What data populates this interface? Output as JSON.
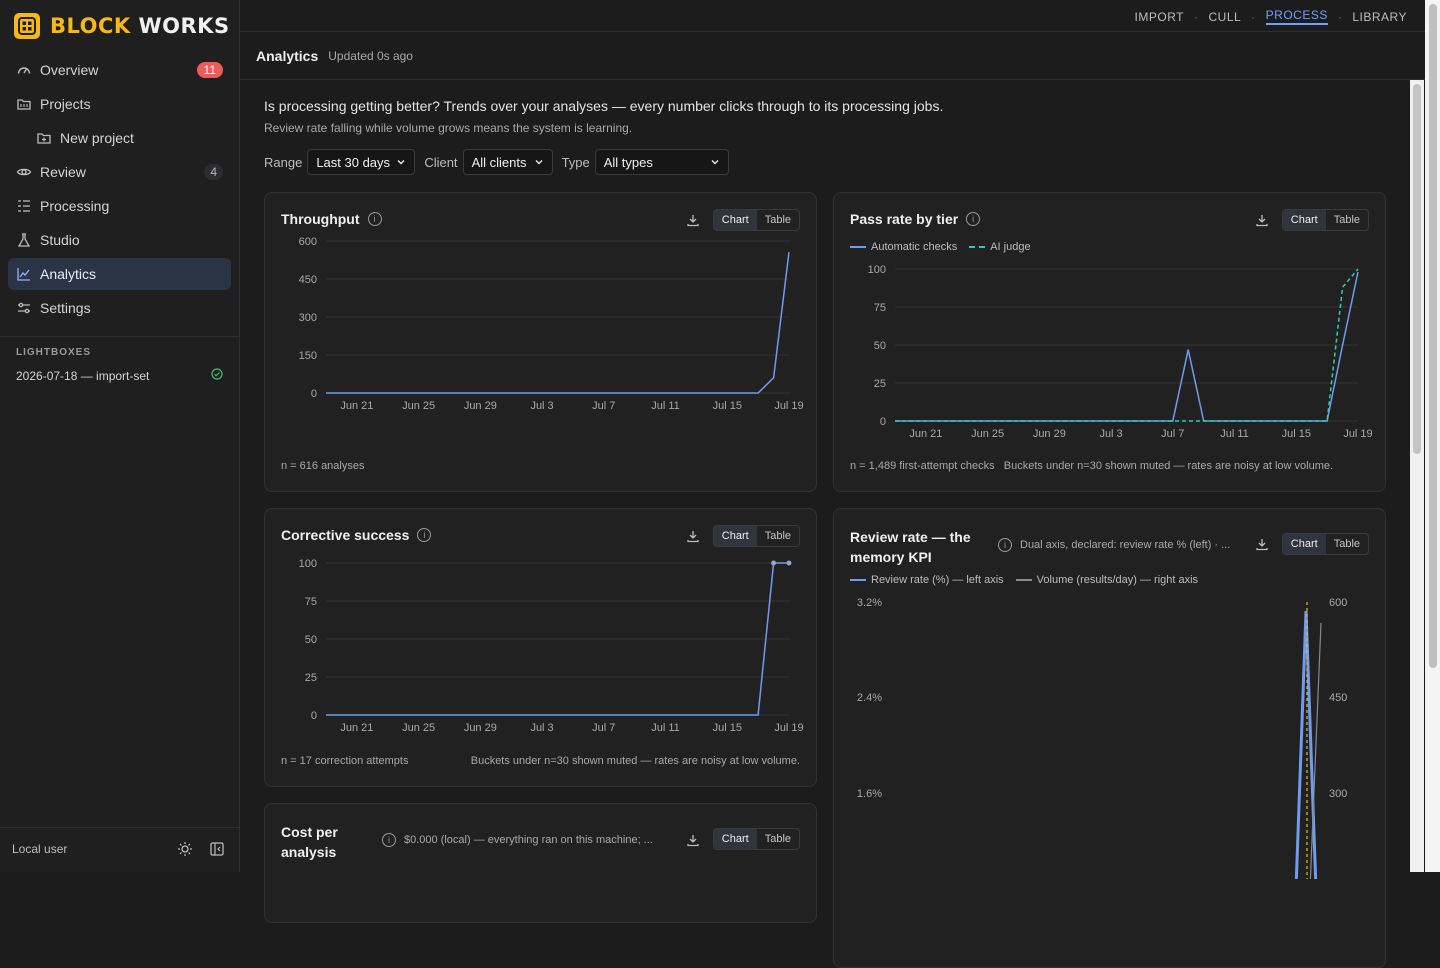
{
  "brand": {
    "part1": "BLOCK",
    "part2": "WORKS"
  },
  "sidebar": {
    "items": [
      {
        "label": "Overview",
        "icon": "gauge-icon",
        "badge": "11"
      },
      {
        "label": "Projects",
        "icon": "folder-icon"
      },
      {
        "label": "New project",
        "icon": "folder-plus-icon"
      },
      {
        "label": "Review",
        "icon": "eye-icon",
        "badge": "4"
      },
      {
        "label": "Processing",
        "icon": "list-icon"
      },
      {
        "label": "Studio",
        "icon": "flask-icon"
      },
      {
        "label": "Analytics",
        "icon": "chart-icon"
      },
      {
        "label": "Settings",
        "icon": "sliders-icon"
      }
    ],
    "lightboxes_heading": "LIGHTBOXES",
    "lightbox_item": "2026-07-18 — import-set",
    "user": "Local user"
  },
  "topnav": [
    "IMPORT",
    "CULL",
    "PROCESS",
    "LIBRARY"
  ],
  "header": {
    "title": "Analytics",
    "updated": "Updated 0s ago"
  },
  "intro": {
    "question": "Is processing getting better? Trends over your analyses — every number clicks through to its processing jobs.",
    "hint": "Review rate falling while volume grows means the system is learning."
  },
  "filters": {
    "range_label": "Range",
    "range_value": "Last 30 days",
    "client_label": "Client",
    "client_value": "All clients",
    "type_label": "Type",
    "type_value": "All types"
  },
  "toggle": {
    "chart": "Chart",
    "table": "Table"
  },
  "colors": {
    "accent": "#6fa0ff",
    "series_blue": "#6f9cf0",
    "series_teal": "#2fd0b0",
    "brand": "#f5b814",
    "badge": "#f15a5a"
  },
  "cards": {
    "throughput": {
      "title": "Throughput",
      "footer": "n = 616 analyses"
    },
    "passrate": {
      "title": "Pass rate by tier",
      "legend1": "Automatic checks",
      "legend2": "AI judge",
      "footer": "n = 1,489 first-attempt checks",
      "footer2": "Buckets under n=30 shown muted — rates are noisy at low volume."
    },
    "corrective": {
      "title": "Corrective success",
      "footer": "n = 17 correction attempts",
      "footer2": "Buckets under n=30 shown muted — rates are noisy at low volume."
    },
    "review": {
      "title1": "Review rate — the",
      "title2": "memory KPI",
      "note": "Dual axis, declared: review rate % (left) · ...",
      "legend1": "Review rate (%) — left axis",
      "legend2": "Volume (results/day) — right axis"
    },
    "cost": {
      "title1": "Cost per",
      "title2": "analysis",
      "note": "$0.000 (local) — everything ran on this machine; ..."
    }
  },
  "chart_data": [
    {
      "type": "line",
      "title": "Throughput",
      "x": [
        "Jun 19",
        "Jun 20",
        "Jun 21",
        "Jun 22",
        "Jun 23",
        "Jun 24",
        "Jun 25",
        "Jun 26",
        "Jun 27",
        "Jun 28",
        "Jun 29",
        "Jun 30",
        "Jul 1",
        "Jul 2",
        "Jul 3",
        "Jul 4",
        "Jul 5",
        "Jul 6",
        "Jul 7",
        "Jul 8",
        "Jul 9",
        "Jul 10",
        "Jul 11",
        "Jul 12",
        "Jul 13",
        "Jul 14",
        "Jul 15",
        "Jul 16",
        "Jul 17",
        "Jul 18",
        "Jul 19"
      ],
      "xticks": [
        "Jun 21",
        "Jun 25",
        "Jun 29",
        "Jul 3",
        "Jul 7",
        "Jul 11",
        "Jul 15",
        "Jul 19"
      ],
      "yticks": [
        0,
        150,
        300,
        450,
        600
      ],
      "ylim": [
        0,
        600
      ],
      "series": [
        {
          "values": [
            0,
            0,
            0,
            0,
            0,
            0,
            0,
            0,
            0,
            0,
            0,
            0,
            0,
            0,
            0,
            0,
            0,
            0,
            0,
            0,
            0,
            0,
            0,
            0,
            0,
            0,
            0,
            0,
            0,
            60,
            556
          ]
        }
      ]
    },
    {
      "type": "line",
      "title": "Pass rate by tier",
      "x": [
        "Jun 19",
        "Jun 20",
        "Jun 21",
        "Jun 22",
        "Jun 23",
        "Jun 24",
        "Jun 25",
        "Jun 26",
        "Jun 27",
        "Jun 28",
        "Jun 29",
        "Jun 30",
        "Jul 1",
        "Jul 2",
        "Jul 3",
        "Jul 4",
        "Jul 5",
        "Jul 6",
        "Jul 7",
        "Jul 8",
        "Jul 9",
        "Jul 10",
        "Jul 11",
        "Jul 12",
        "Jul 13",
        "Jul 14",
        "Jul 15",
        "Jul 16",
        "Jul 17",
        "Jul 18",
        "Jul 19"
      ],
      "xticks": [
        "Jun 21",
        "Jun 25",
        "Jun 29",
        "Jul 3",
        "Jul 7",
        "Jul 11",
        "Jul 15",
        "Jul 19"
      ],
      "yticks": [
        0,
        25,
        50,
        75,
        100
      ],
      "ylim": [
        0,
        100
      ],
      "series": [
        {
          "name": "Automatic checks",
          "values": [
            0,
            0,
            0,
            0,
            0,
            0,
            0,
            0,
            0,
            0,
            0,
            0,
            0,
            0,
            0,
            0,
            0,
            0,
            0,
            47,
            0,
            0,
            0,
            0,
            0,
            0,
            0,
            0,
            0,
            50,
            98
          ]
        },
        {
          "name": "AI judge",
          "values": [
            0,
            0,
            0,
            0,
            0,
            0,
            0,
            0,
            0,
            0,
            0,
            0,
            0,
            0,
            0,
            0,
            0,
            0,
            0,
            0,
            0,
            0,
            0,
            0,
            0,
            0,
            0,
            0,
            0,
            88,
            100
          ]
        }
      ]
    },
    {
      "type": "line",
      "title": "Corrective success",
      "x": [
        "Jun 19",
        "Jun 20",
        "Jun 21",
        "Jun 22",
        "Jun 23",
        "Jun 24",
        "Jun 25",
        "Jun 26",
        "Jun 27",
        "Jun 28",
        "Jun 29",
        "Jun 30",
        "Jul 1",
        "Jul 2",
        "Jul 3",
        "Jul 4",
        "Jul 5",
        "Jul 6",
        "Jul 7",
        "Jul 8",
        "Jul 9",
        "Jul 10",
        "Jul 11",
        "Jul 12",
        "Jul 13",
        "Jul 14",
        "Jul 15",
        "Jul 16",
        "Jul 17",
        "Jul 18",
        "Jul 19"
      ],
      "xticks": [
        "Jun 21",
        "Jun 25",
        "Jun 29",
        "Jul 3",
        "Jul 7",
        "Jul 11",
        "Jul 15",
        "Jul 19"
      ],
      "yticks": [
        0,
        25,
        50,
        75,
        100
      ],
      "ylim": [
        0,
        100
      ],
      "series": [
        {
          "values": [
            0,
            0,
            0,
            0,
            0,
            0,
            0,
            0,
            0,
            0,
            0,
            0,
            0,
            0,
            0,
            0,
            0,
            0,
            0,
            0,
            0,
            0,
            0,
            0,
            0,
            0,
            0,
            0,
            0,
            100,
            100
          ]
        }
      ]
    },
    {
      "type": "line",
      "title": "Review rate — the memory KPI",
      "yticks_left": [
        "3.2%",
        "2.4%",
        "1.6%"
      ],
      "yticks_right": [
        600,
        450,
        300
      ],
      "series": [
        {
          "name": "Review rate (%) — left axis",
          "values": [
            0,
            3.1,
            0
          ]
        },
        {
          "name": "Volume (results/day) — right axis",
          "values": [
            0,
            556
          ]
        }
      ]
    }
  ]
}
